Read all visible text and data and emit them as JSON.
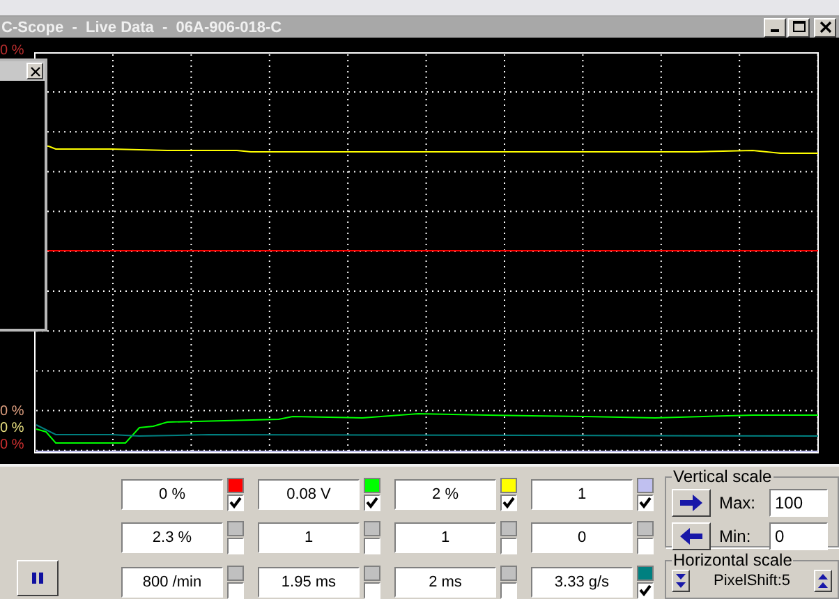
{
  "window": {
    "title": "C-Scope  -  Live Data  -  06A-906-018-C"
  },
  "axis_top_labels": [
    {
      "text": "0 %",
      "color": "#c03030"
    }
  ],
  "axis_bottom_labels": [
    {
      "text": "0 %",
      "color": "#e0a080"
    },
    {
      "text": "0 %",
      "color": "#e8e080"
    },
    {
      "text": "0 %",
      "color": "#d03030"
    }
  ],
  "channels": [
    {
      "value": "0 %",
      "color": "#ff0000",
      "checked": true
    },
    {
      "value": "0.08 V",
      "color": "#00ff00",
      "checked": true
    },
    {
      "value": "2 %",
      "color": "#ffff00",
      "checked": true
    },
    {
      "value": "1",
      "color": "#c0c0f0",
      "checked": true
    },
    {
      "value": "2.3 %",
      "color": "#c0c0c0",
      "checked": false
    },
    {
      "value": "1",
      "color": "#c0c0c0",
      "checked": false
    },
    {
      "value": "1",
      "color": "#c0c0c0",
      "checked": false
    },
    {
      "value": "0",
      "color": "#c0c0c0",
      "checked": false
    },
    {
      "value": "800 /min",
      "color": "#c0c0c0",
      "checked": false
    },
    {
      "value": "1.95 ms",
      "color": "#c0c0c0",
      "checked": false
    },
    {
      "value": "2 ms",
      "color": "#c0c0c0",
      "checked": false
    },
    {
      "value": "3.33 g/s",
      "color": "#008080",
      "checked": true
    }
  ],
  "vertical_scale": {
    "title": "Vertical scale",
    "max_label": "Max:",
    "max": "100",
    "min_label": "Min:",
    "min": "0"
  },
  "horizontal_scale": {
    "title": "Horizontal scale",
    "label": "PixelShift:5"
  }
}
